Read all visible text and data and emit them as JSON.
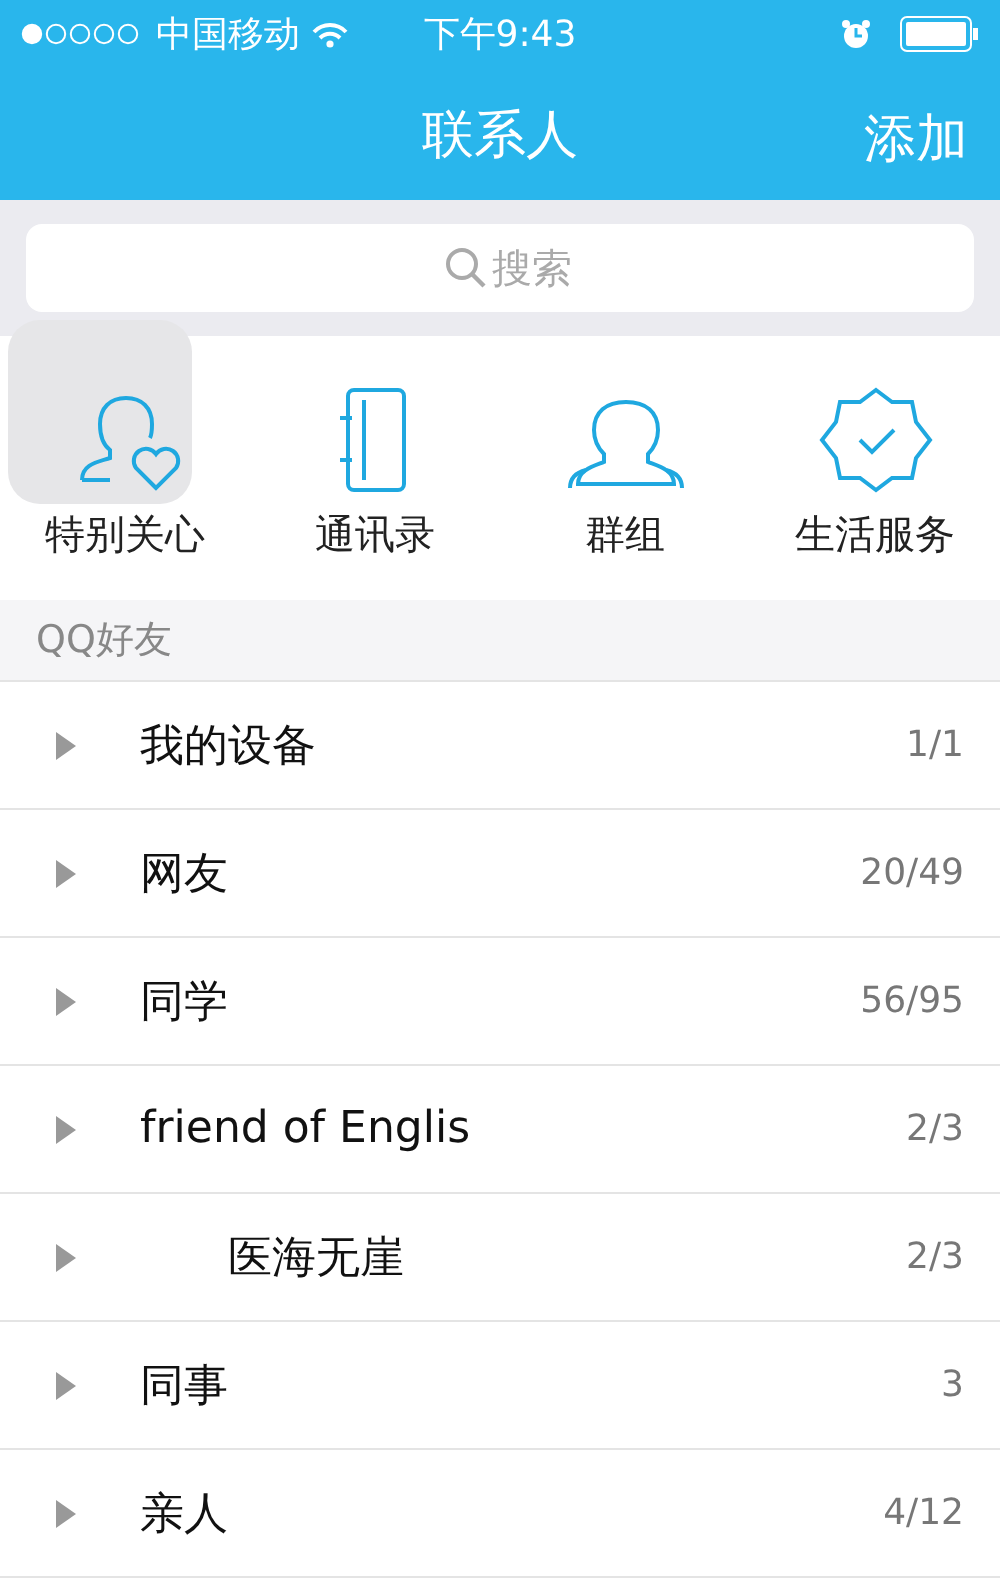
{
  "status_bar": {
    "carrier": "中国移动",
    "time": "下午9:43"
  },
  "nav": {
    "title": "联系人",
    "action": "添加"
  },
  "search": {
    "placeholder": "搜索"
  },
  "shortcuts": [
    {
      "kind": "care",
      "label": "特别关心",
      "selected": true
    },
    {
      "kind": "book",
      "label": "通讯录",
      "selected": false
    },
    {
      "kind": "group",
      "label": "群组",
      "selected": false
    },
    {
      "kind": "service",
      "label": "生活服务",
      "selected": false
    }
  ],
  "section": "QQ好友",
  "groups": [
    {
      "name": "我的设备",
      "count": "1/1"
    },
    {
      "name": "网友",
      "count": "20/49"
    },
    {
      "name": "同学",
      "count": "56/95"
    },
    {
      "name": "friend of Englis",
      "count": "2/3"
    },
    {
      "name": "　　医海无崖",
      "count": "2/3"
    },
    {
      "name": "同事",
      "count": "3"
    },
    {
      "name": "亲人",
      "count": "4/12"
    }
  ]
}
